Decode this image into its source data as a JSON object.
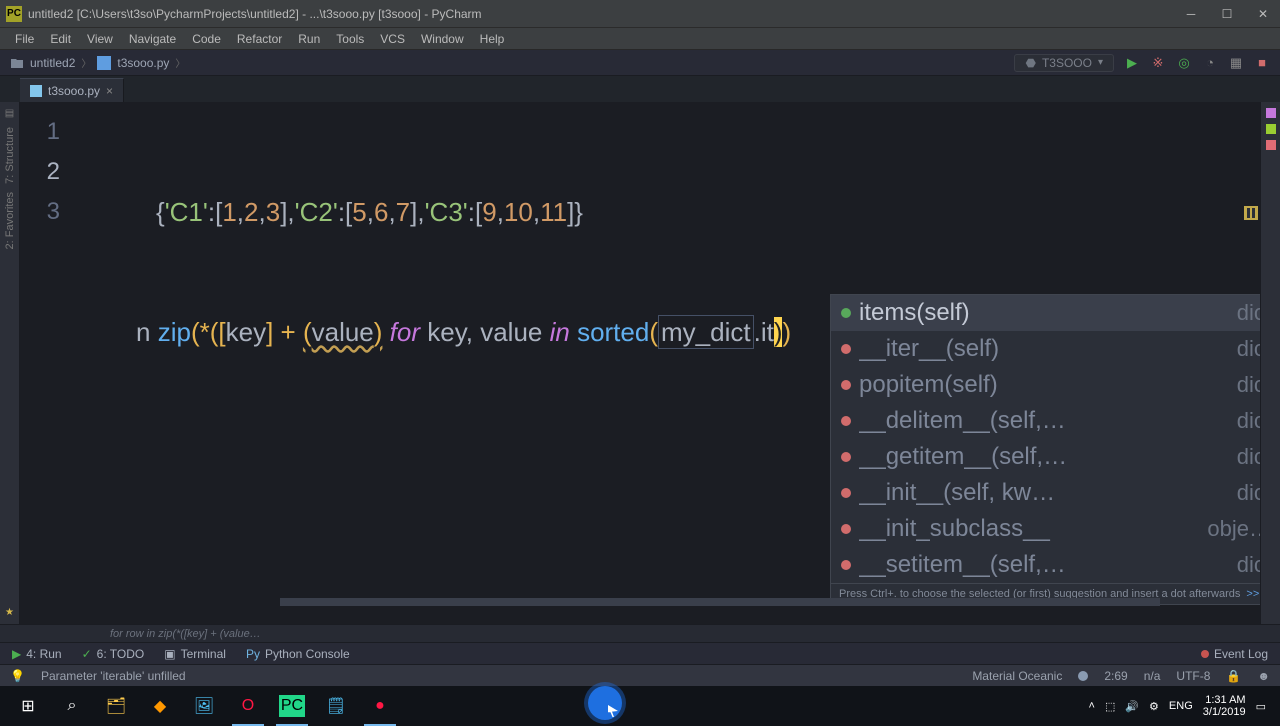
{
  "window": {
    "title": "untitled2 [C:\\Users\\t3so\\PycharmProjects\\untitled2] - ...\\t3sooo.py [t3sooo] - PyCharm"
  },
  "menus": [
    "File",
    "Edit",
    "View",
    "Navigate",
    "Code",
    "Refactor",
    "Run",
    "Tools",
    "VCS",
    "Window",
    "Help"
  ],
  "breadcrumb": {
    "project": "untitled2",
    "file": "t3sooo.py"
  },
  "run_config": "T3SOOO",
  "tab": {
    "name": "t3sooo.py"
  },
  "code": {
    "line1": "{'C1':[1,2,3],'C2':[5,6,7],'C3':[9,10,11]}",
    "line2_pre_n": "n ",
    "line2_zip": "zip",
    "line2_open": "(*([",
    "line2_key": "key",
    "line2_mid1": "] + ",
    "line2_lp": "(",
    "line2_value": "value",
    "line2_rp": ")",
    "line2_for": " for ",
    "line2_key2": "key",
    "line2_comma": ", ",
    "line2_value2": "value",
    "line2_in": " in ",
    "line2_sorted": "sorted",
    "line2_lp2": "(",
    "line2_mydict": "my_dict",
    "line2_dot": ".",
    "line2_it": "it",
    "line2_close": "))",
    "line_numbers": [
      "1",
      "2",
      "3"
    ]
  },
  "autocomplete": {
    "items": [
      {
        "name": "items(self)",
        "type": "dict"
      },
      {
        "name": "__iter__(self)",
        "type": "dict"
      },
      {
        "name": "popitem(self)",
        "type": "dict"
      },
      {
        "name": "__delitem__(self,…",
        "type": "dict"
      },
      {
        "name": "__getitem__(self,…",
        "type": "dict"
      },
      {
        "name": "__init__(self, kw…",
        "type": "dict"
      },
      {
        "name": "__init_subclass__",
        "type": "obje…"
      },
      {
        "name": "__setitem__(self,…",
        "type": "dict"
      }
    ],
    "hint": "Press Ctrl+. to choose the selected (or first) suggestion and insert a dot afterwards",
    "hint_arrow": ">>"
  },
  "context_line": "for row in zip(*([key] + (value…",
  "bottom_tools": {
    "run": "4: Run",
    "todo": "6: TODO",
    "terminal": "Terminal",
    "python_console": "Python Console",
    "event_log": "Event Log"
  },
  "status": {
    "message": "Parameter 'iterable' unfilled",
    "theme": "Material Oceanic",
    "pos": "2:69",
    "rw": "n/a",
    "encoding": "UTF-8",
    "lock_icon": "🔒"
  },
  "tray": {
    "lang": "ENG",
    "time": "1:31 AM",
    "date": "3/1/2019"
  }
}
